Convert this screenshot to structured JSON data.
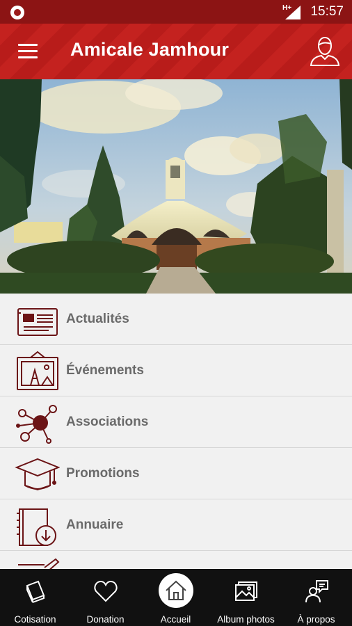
{
  "status_bar": {
    "network": "H+",
    "time": "15:57"
  },
  "app_bar": {
    "title": "Amicale Jamhour",
    "menu_icon": "hamburger-menu-icon",
    "profile_icon": "user-profile-icon"
  },
  "carousel": {
    "image": "church-building-photo",
    "slides_total": 3,
    "active_slide": 1
  },
  "menu": {
    "items": [
      {
        "label": "Actualités",
        "icon": "newspaper-icon"
      },
      {
        "label": "Événements",
        "icon": "framed-picture-icon"
      },
      {
        "label": "Associations",
        "icon": "network-nodes-icon"
      },
      {
        "label": "Promotions",
        "icon": "graduation-cap-icon"
      },
      {
        "label": "Annuaire",
        "icon": "address-book-download-icon"
      },
      {
        "label": "",
        "icon": "notebook-pencil-icon"
      }
    ]
  },
  "bottom_nav": {
    "items": [
      {
        "label": "Cotisation",
        "icon": "book-icon"
      },
      {
        "label": "Donation",
        "icon": "heart-icon"
      },
      {
        "label": "Accueil",
        "icon": "home-icon",
        "active": true
      },
      {
        "label": "Album photos",
        "icon": "photo-album-icon"
      },
      {
        "label": "À propos",
        "icon": "person-speech-bubble-icon"
      }
    ]
  },
  "colors": {
    "brand_red": "#c4221f",
    "status_red": "#8c1414",
    "icon_maroon": "#6b1416",
    "nav_bg": "#111111",
    "label_grey": "#6a6a6a"
  }
}
